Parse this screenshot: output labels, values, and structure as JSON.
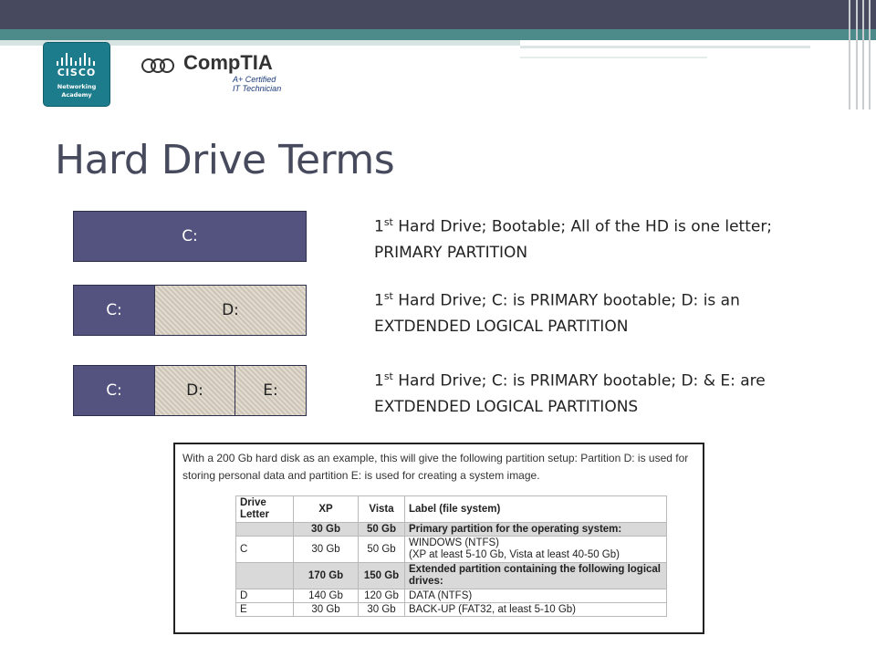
{
  "header": {
    "cisco_brand": "CISCO",
    "cisco_sub_line1": "Networking",
    "cisco_sub_line2": "Academy",
    "comptia_word": "CompTIA",
    "comptia_cert_line1": "A+ Certified",
    "comptia_cert_line2": "IT Technician"
  },
  "title": "Hard Drive Terms",
  "drives": [
    {
      "segments": [
        "C:"
      ],
      "desc_ordinal": "1",
      "desc_sup": "st",
      "desc_text": " Hard Drive; Bootable; All of the HD is one letter; PRIMARY PARTITION"
    },
    {
      "segments": [
        "C:",
        "D:"
      ],
      "desc_ordinal": "1",
      "desc_sup": "st",
      "desc_text": " Hard Drive; C: is PRIMARY bootable; D: is an EXTDENDED LOGICAL PARTITION"
    },
    {
      "segments": [
        "C:",
        "D:",
        "E:"
      ],
      "desc_ordinal": "1",
      "desc_sup": "st",
      "desc_text": " Hard Drive; C: is PRIMARY bootable; D: & E: are EXTDENDED LOGICAL PARTITIONS"
    }
  ],
  "table_shot": {
    "intro": "With a 200 Gb hard disk as an example, this will give the following partition setup: Partition D: is used for storing personal data and partition E: is used for creating a system image.",
    "headers": [
      "Drive Letter",
      "XP",
      "Vista",
      "Label (file system)"
    ],
    "rows": [
      [
        "",
        "30 Gb",
        "50 Gb",
        "Primary partition for the operating system:"
      ],
      [
        "C",
        "30 Gb",
        "50 Gb",
        "WINDOWS (NTFS)"
      ],
      [
        "",
        "170 Gb",
        "150 Gb",
        "Extended partition containing the following logical drives:"
      ],
      [
        "D",
        "140 Gb",
        "120 Gb",
        "DATA (NTFS)"
      ],
      [
        "E",
        "30 Gb",
        "30 Gb",
        "BACK-UP (FAT32, at least 5-10 Gb)"
      ]
    ],
    "row1_note": "(XP at least 5-10 Gb, Vista at least 40-50 Gb)"
  },
  "colors": {
    "primary": "#54527f",
    "extended": "#d7cfc0",
    "title": "#464a5c"
  }
}
